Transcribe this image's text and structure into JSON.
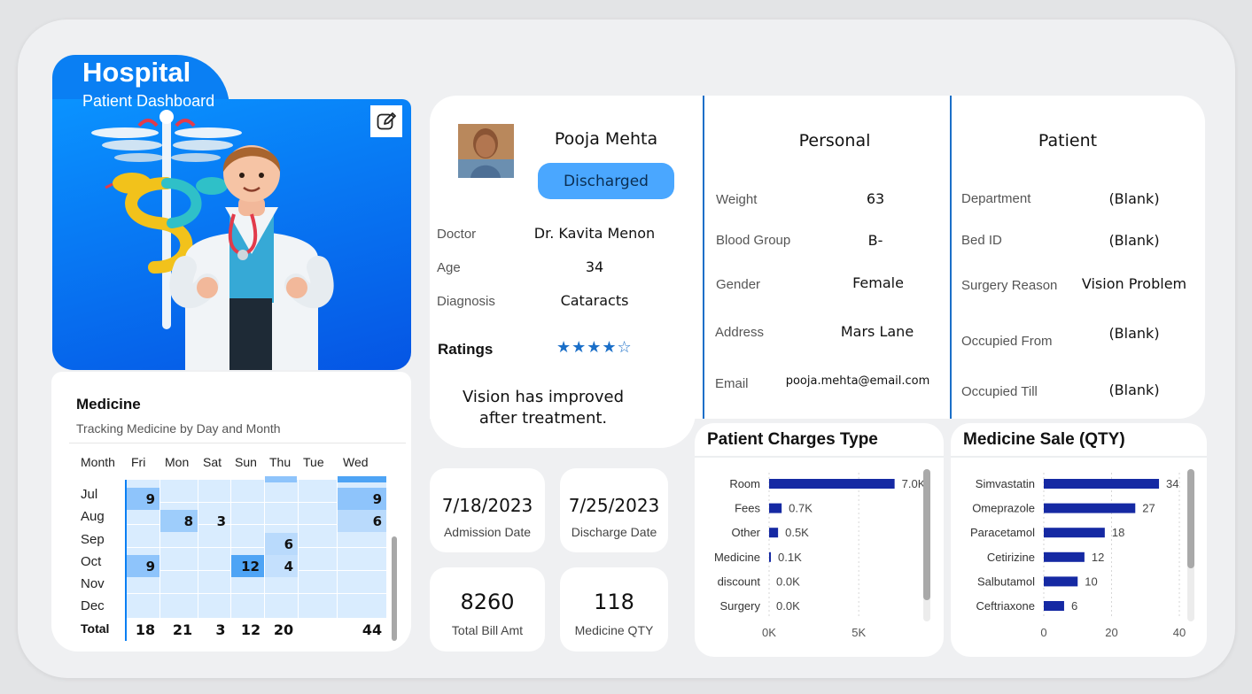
{
  "header": {
    "title": "Hospital",
    "subtitle": "Patient Dashboard",
    "edit_icon": "edit-icon"
  },
  "medicine": {
    "title": "Medicine",
    "subtitle": "Tracking Medicine by Day and Month",
    "columns": [
      "Month",
      "Fri",
      "Mon",
      "Sat",
      "Sun",
      "Thu",
      "Tue",
      "Wed"
    ],
    "rows": [
      {
        "month": "Jul",
        "values": [
          "9",
          "",
          "",
          "",
          "",
          "",
          "9"
        ]
      },
      {
        "month": "Aug",
        "values": [
          "",
          "8",
          "3",
          "",
          "",
          "",
          "6"
        ]
      },
      {
        "month": "Sep",
        "values": [
          "",
          "",
          "",
          "",
          "6",
          "",
          ""
        ]
      },
      {
        "month": "Oct",
        "values": [
          "9",
          "",
          "",
          "12",
          "4",
          "",
          ""
        ]
      },
      {
        "month": "Nov",
        "values": [
          "",
          "",
          "",
          "",
          "",
          "",
          ""
        ]
      },
      {
        "month": "Dec",
        "values": [
          "",
          "",
          "",
          "",
          "",
          "",
          ""
        ]
      }
    ],
    "total_label": "Total",
    "totals": [
      "18",
      "21",
      "3",
      "12",
      "20",
      "",
      "44"
    ]
  },
  "patient": {
    "name": "Pooja Mehta",
    "status": "Discharged",
    "doctor_label": "Doctor",
    "doctor": "Dr. Kavita Menon",
    "age_label": "Age",
    "age": "34",
    "diagnosis_label": "Diagnosis",
    "diagnosis": "Cataracts",
    "ratings_label": "Ratings",
    "rating": 4,
    "rating_max": 5,
    "stars": "★★★★☆",
    "note": "Vision has improved after treatment."
  },
  "personal": {
    "title": "Personal",
    "weight_label": "Weight",
    "weight": "63",
    "blood_label": "Blood Group",
    "blood": "B-",
    "gender_label": "Gender",
    "gender": "Female",
    "address_label": "Address",
    "address": "Mars Lane",
    "email_label": "Email",
    "email": "pooja.mehta@email.com"
  },
  "admission": {
    "title": "Patient",
    "department_label": "Department",
    "department": "(Blank)",
    "bed_label": "Bed ID",
    "bed": "(Blank)",
    "surgery_label": "Surgery Reason",
    "surgery": "Vision Problem",
    "from_label": "Occupied From",
    "from": "(Blank)",
    "till_label": "Occupied Till",
    "till": "(Blank)"
  },
  "kpis": {
    "admission_date": "7/18/2023",
    "admission_label": "Admission Date",
    "discharge_date": "7/25/2023",
    "discharge_label": "Discharge Date",
    "total_bill": "8260",
    "total_bill_label": "Total Bill Amt",
    "medicine_qty": "118",
    "medicine_qty_label": "Medicine QTY"
  },
  "chart_data": [
    {
      "type": "bar",
      "orientation": "horizontal",
      "title": "Patient Charges Type",
      "categories": [
        "Room",
        "Fees",
        "Other",
        "Medicine",
        "discount",
        "Surgery"
      ],
      "values": [
        7000,
        700,
        500,
        100,
        0,
        0
      ],
      "value_labels": [
        "7.0K",
        "0.7K",
        "0.5K",
        "0.1K",
        "0.0K",
        "0.0K"
      ],
      "xticks": [
        "0K",
        "5K"
      ],
      "xtick_values": [
        0,
        5000
      ],
      "xlim": [
        0,
        8500
      ],
      "color": "#1529a3"
    },
    {
      "type": "bar",
      "orientation": "horizontal",
      "title": "Medicine Sale (QTY)",
      "categories": [
        "Simvastatin",
        "Omeprazole",
        "Paracetamol",
        "Cetirizine",
        "Salbutamol",
        "Ceftriaxone"
      ],
      "values": [
        34,
        27,
        18,
        12,
        10,
        6
      ],
      "value_labels": [
        "34",
        "27",
        "18",
        "12",
        "10",
        "6"
      ],
      "xticks": [
        "0",
        "20",
        "40"
      ],
      "xtick_values": [
        0,
        20,
        40
      ],
      "xlim": [
        0,
        40
      ],
      "color": "#1529a3"
    }
  ]
}
